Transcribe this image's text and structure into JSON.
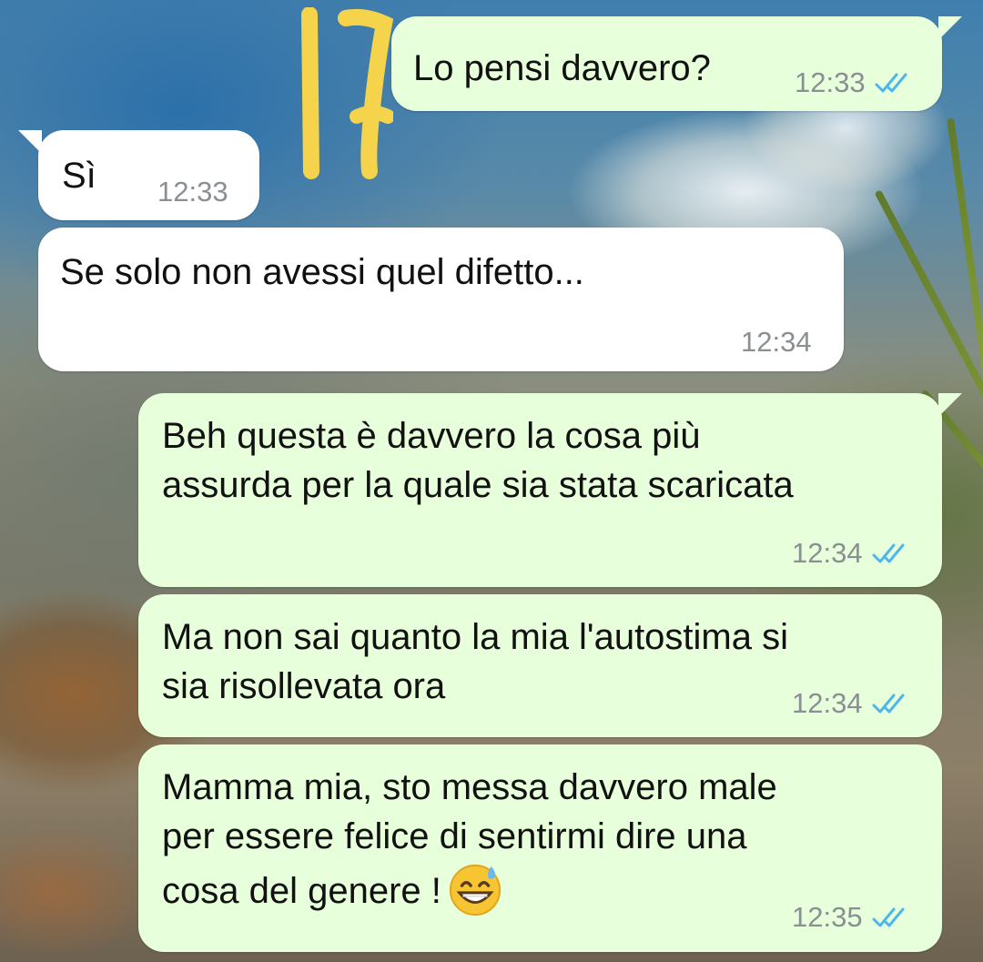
{
  "chat": {
    "messages": [
      {
        "direction": "outgoing",
        "text": "Lo pensi davvero?",
        "time": "12:33",
        "status_icon": "double-check-read-icon"
      },
      {
        "direction": "incoming",
        "text": "Sì",
        "time": "12:33"
      },
      {
        "direction": "incoming",
        "text": "Se solo non avessi quel difetto...",
        "time": "12:34"
      },
      {
        "direction": "outgoing",
        "text": "Beh questa è davvero la cosa più\nassurda per la quale sia stata scaricata",
        "time": "12:34",
        "status_icon": "double-check-read-icon"
      },
      {
        "direction": "outgoing",
        "text": "Ma non sai quanto la mia l'autostima si\nsia risollevata ora",
        "time": "12:34",
        "status_icon": "double-check-read-icon"
      },
      {
        "direction": "outgoing",
        "text": "Mamma mia, sto messa davvero male\nper essere felice di sentirmi dire una\ncosa del genere !",
        "time": "12:35",
        "status_icon": "double-check-read-icon",
        "emoji": "grinning-face-with-sweat-emoji"
      }
    ]
  },
  "colors": {
    "outgoing_bubble": "#e7ffdb",
    "incoming_bubble": "#ffffff",
    "read_ticks": "#4fb6ec",
    "timestamp": "#8a8f93",
    "highlighter": "#f5d34a"
  }
}
